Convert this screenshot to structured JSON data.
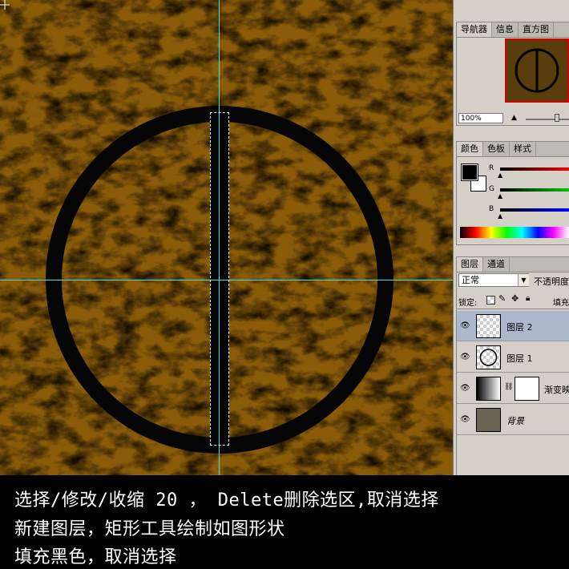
{
  "panels": {
    "navigator": {
      "tabs": [
        "导航器",
        "信息",
        "直方图"
      ],
      "zoom": "100%"
    },
    "color": {
      "tabs": [
        "颜色",
        "色板",
        "样式"
      ],
      "channels": [
        {
          "label": "R",
          "value": 0
        },
        {
          "label": "G",
          "value": 0
        },
        {
          "label": "B",
          "value": 0
        }
      ],
      "foreground": "#000000",
      "background": "#ffffff"
    },
    "layers": {
      "tabs": [
        "图层",
        "通道"
      ],
      "blend_mode": "正常",
      "opacity_label": "不透明度",
      "lock_label": "锁定:",
      "fill_label": "填充",
      "items": [
        {
          "name": "图层 2",
          "selected": true
        },
        {
          "name": "图层 1",
          "selected": false
        },
        {
          "name": "渐变映",
          "selected": false
        },
        {
          "name": "背景",
          "selected": false
        }
      ]
    }
  },
  "caption": {
    "line1": "选择/修改/收缩 20 ， Delete删除选区,取消选择",
    "line2": "新建图层，矩形工具绘制如图形状",
    "line3": "填充黑色，取消选择"
  },
  "colors": {
    "texture": "#7a5208",
    "guide": "#3fe0e0",
    "selection": "#d40000"
  },
  "icons": [
    "eye-icon",
    "lock-transparent-icon",
    "lock-brush-icon",
    "lock-move-icon",
    "lock-all-icon",
    "link-icon",
    "dropdown-arrow-icon"
  ]
}
